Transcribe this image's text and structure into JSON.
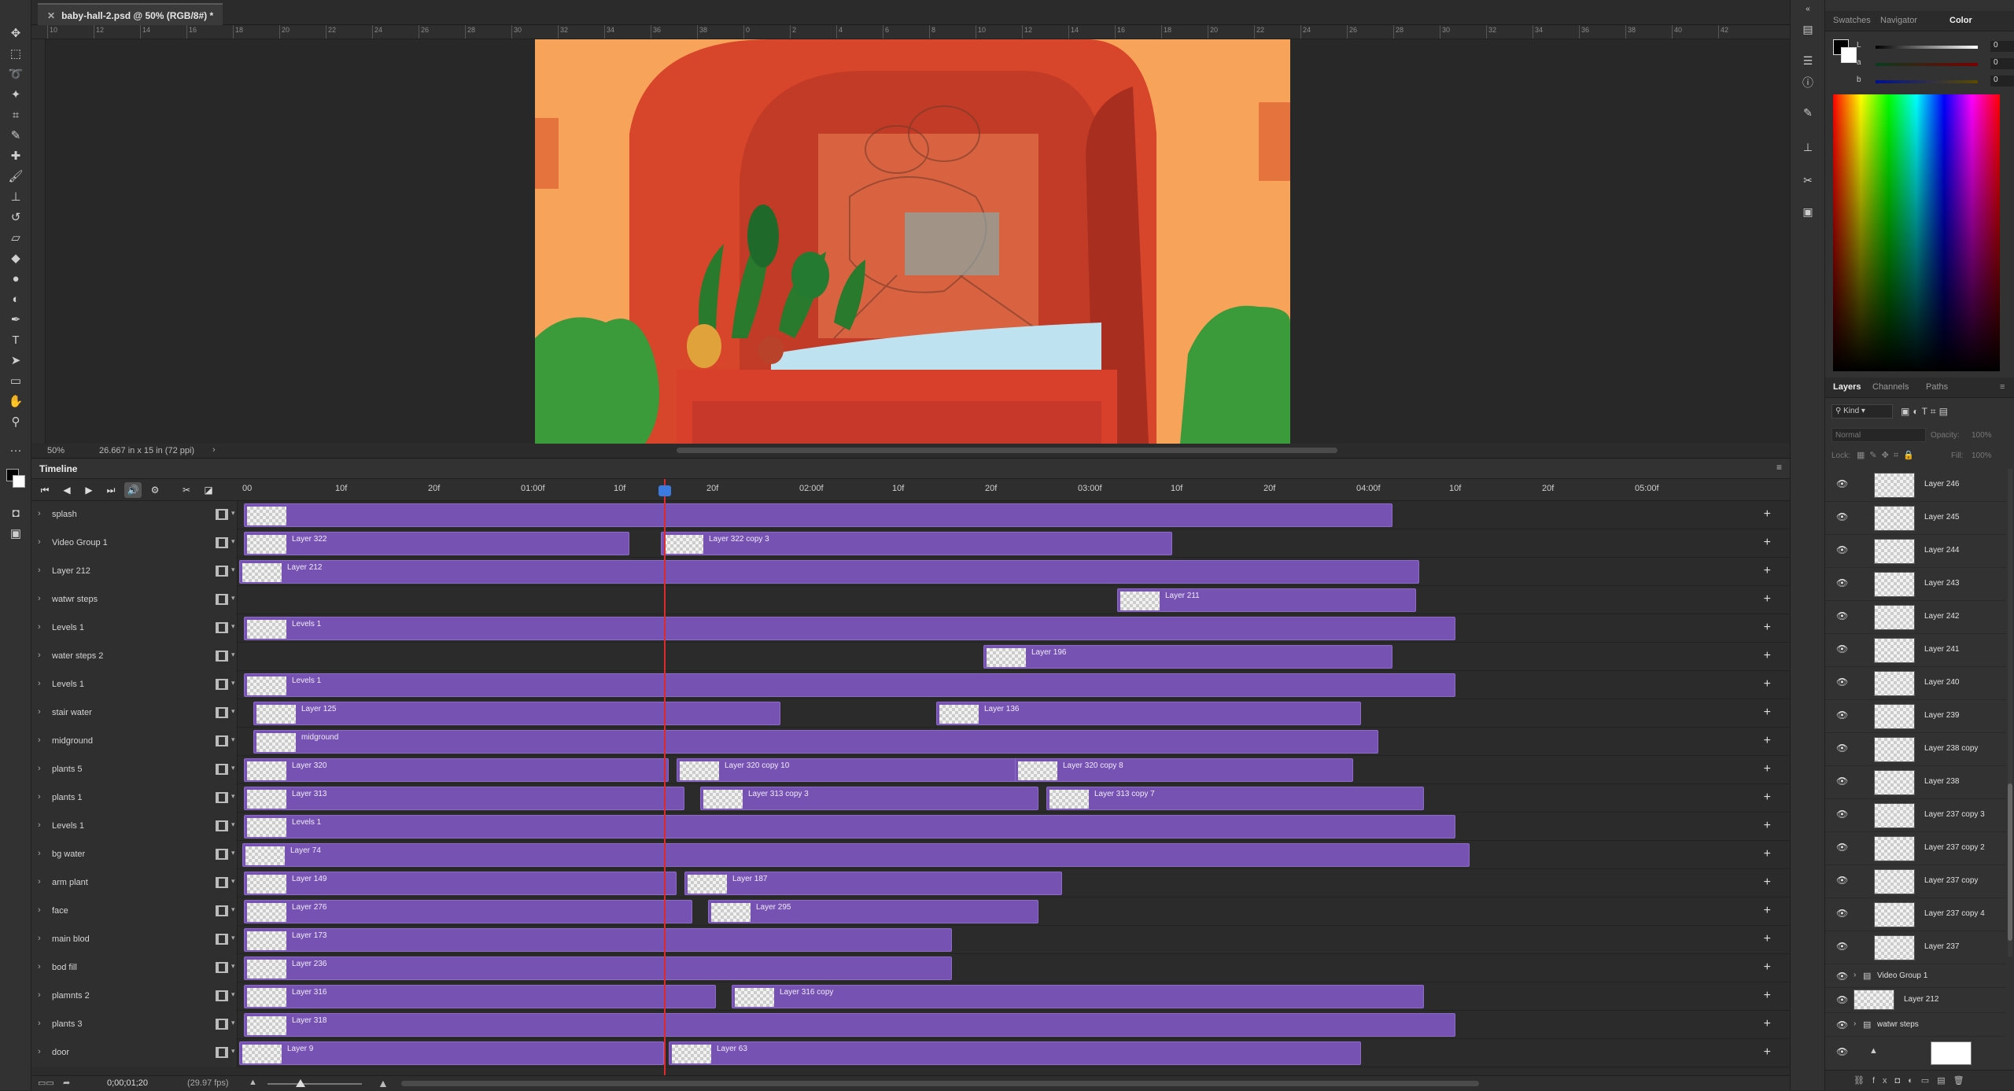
{
  "document": {
    "tab_title": "baby-hall-2.psd @ 50% (RGB/8#) *",
    "zoom": "50%",
    "doc_info": "26.667 in x 15 in (72 ppi)"
  },
  "ruler_marks": [
    "10",
    "12",
    "14",
    "16",
    "18",
    "20",
    "22",
    "24",
    "26",
    "28",
    "30",
    "32",
    "34",
    "36",
    "38",
    "0",
    "2",
    "4",
    "6",
    "8",
    "10",
    "12",
    "14",
    "16",
    "18",
    "20",
    "22",
    "24",
    "26",
    "28",
    "30",
    "32",
    "34",
    "36",
    "38",
    "40",
    "42"
  ],
  "toolbar": {
    "icons": [
      "move-icon",
      "marquee-icon",
      "lasso-icon",
      "magic-wand-icon",
      "crop-icon",
      "eyedropper-icon",
      "healing-brush-icon",
      "brush-icon",
      "clone-stamp-icon",
      "history-brush-icon",
      "eraser-icon",
      "paint-bucket-icon",
      "blur-icon",
      "dodge-icon",
      "pen-icon",
      "type-icon",
      "path-select-icon",
      "rectangle-icon",
      "hand-icon",
      "zoom-icon",
      "more-tools-icon"
    ]
  },
  "timeline": {
    "panel_title": "Timeline",
    "time_marks": [
      "00",
      "10f",
      "20f",
      "01:00f",
      "10f",
      "20f",
      "02:00f",
      "10f",
      "20f",
      "03:00f",
      "10f",
      "20f",
      "04:00f",
      "10f",
      "20f",
      "05:00f"
    ],
    "current_time": "0;00;01;20",
    "fps": "(29.97 fps)",
    "tracks": [
      {
        "name": "splash",
        "clips": [
          {
            "label": ""
          }
        ]
      },
      {
        "name": "Video Group 1",
        "clips": [
          {
            "label": "Layer 322"
          },
          {
            "label": "Layer 322 copy 3"
          }
        ]
      },
      {
        "name": "Layer 212",
        "clips": [
          {
            "label": "Layer 212"
          }
        ]
      },
      {
        "name": "watwr steps",
        "clips": [
          {
            "label": "Layer 211"
          }
        ]
      },
      {
        "name": "Levels 1",
        "clips": [
          {
            "label": "Levels 1"
          }
        ]
      },
      {
        "name": "water steps 2",
        "clips": [
          {
            "label": "Layer 196"
          }
        ]
      },
      {
        "name": "Levels 1",
        "clips": [
          {
            "label": "Levels 1"
          }
        ]
      },
      {
        "name": "stair water",
        "clips": [
          {
            "label": "Layer 125"
          },
          {
            "label": "Layer 136"
          }
        ]
      },
      {
        "name": "midground",
        "clips": [
          {
            "label": "midground"
          }
        ]
      },
      {
        "name": "plants 5",
        "clips": [
          {
            "label": "Layer 320"
          },
          {
            "label": "Layer 320 copy 10"
          },
          {
            "label": "Layer 320 copy 8"
          }
        ]
      },
      {
        "name": "plants 1",
        "clips": [
          {
            "label": "Layer 313"
          },
          {
            "label": "Layer 313 copy 3"
          },
          {
            "label": "Layer 313 copy 7"
          }
        ]
      },
      {
        "name": "Levels 1",
        "clips": [
          {
            "label": "Levels 1"
          }
        ]
      },
      {
        "name": "bg water",
        "clips": [
          {
            "label": "Layer 74"
          }
        ]
      },
      {
        "name": "arm plant",
        "clips": [
          {
            "label": "Layer 149"
          },
          {
            "label": "Layer 187"
          }
        ]
      },
      {
        "name": "face",
        "clips": [
          {
            "label": "Layer 276"
          },
          {
            "label": "Layer 295"
          }
        ]
      },
      {
        "name": "main blod",
        "clips": [
          {
            "label": "Layer 173"
          }
        ]
      },
      {
        "name": "bod fill",
        "clips": [
          {
            "label": "Layer 236"
          }
        ]
      },
      {
        "name": "plamnts 2",
        "clips": [
          {
            "label": "Layer 316"
          },
          {
            "label": "Layer 316 copy"
          }
        ]
      },
      {
        "name": "plants 3",
        "clips": [
          {
            "label": "Layer 318"
          }
        ]
      },
      {
        "name": "door",
        "clips": [
          {
            "label": "Layer 9"
          },
          {
            "label": "Layer 63"
          }
        ]
      }
    ]
  },
  "color_panel": {
    "tabs": [
      "Swatches",
      "Navigator",
      "Color"
    ],
    "active_tab": "Color",
    "sliders": [
      {
        "label": "L",
        "value": "0"
      },
      {
        "label": "a",
        "value": "0"
      },
      {
        "label": "b",
        "value": "0"
      }
    ]
  },
  "layers_panel": {
    "tabs": [
      "Layers",
      "Channels",
      "Paths"
    ],
    "active_tab": "Layers",
    "filter_kind": "Kind",
    "blend_mode": "Normal",
    "opacity_label": "Opacity:",
    "opacity_value": "100%",
    "lock_label": "Lock:",
    "fill_label": "Fill:",
    "fill_value": "100%",
    "layers": [
      "Layer 246",
      "Layer 245",
      "Layer 244",
      "Layer 243",
      "Layer 242",
      "Layer 241",
      "Layer 240",
      "Layer 239",
      "Layer 238 copy",
      "Layer 238",
      "Layer 237 copy 3",
      "Layer 237 copy 2",
      "Layer 237 copy",
      "Layer 237 copy 4",
      "Layer 237"
    ],
    "groups": [
      "Video Group 1",
      "Layer 212",
      "watwr steps"
    ]
  },
  "colors": {
    "clip": "#7653b3",
    "playhead": "#e02a2a",
    "artboard_bg": "#f59a50"
  }
}
